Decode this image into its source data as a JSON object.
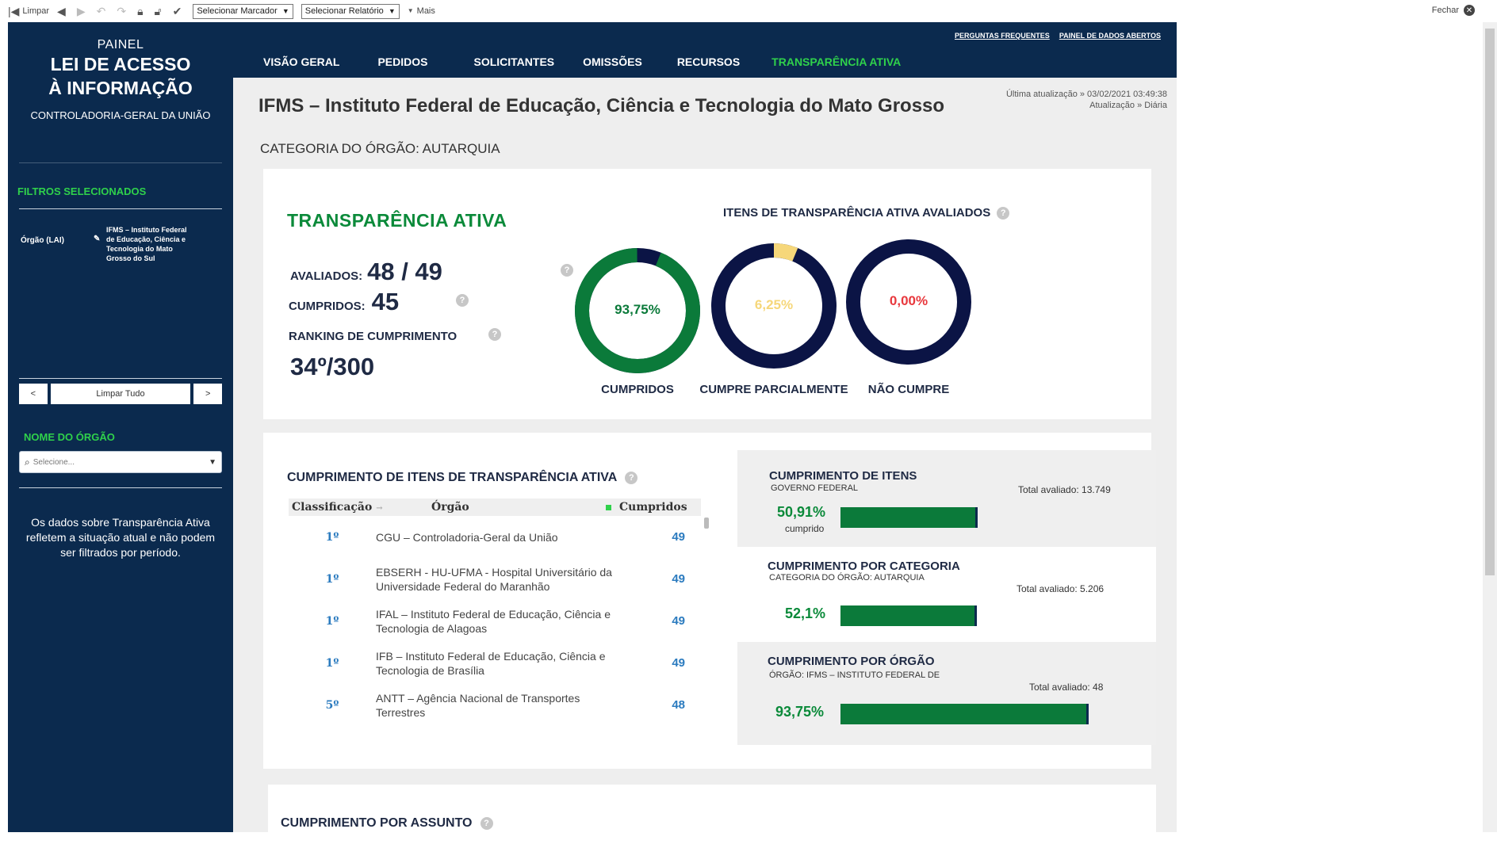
{
  "toolbar": {
    "clear": "Limpar",
    "select_bookmark": "Selecionar Marcador",
    "select_report": "Selecionar Relatório",
    "more": "Mais",
    "close": "Fechar"
  },
  "sidebar": {
    "brand": {
      "line1": "PAINEL",
      "line2": "LEI DE ACESSO",
      "line3": "À INFORMAÇÃO",
      "line4": "CONTROLADORIA-GERAL DA UNIÃO"
    },
    "filters_heading": "FILTROS SELECIONADOS",
    "filter": {
      "key": "Órgão (LAI)",
      "value": "IFMS – Instituto Federal de Educação, Ciência e Tecnologia do Mato Grosso do Sul"
    },
    "prev_label": "<",
    "clear_all": "Limpar Tudo",
    "next_label": ">",
    "org_heading": "NOME DO ÓRGÃO",
    "search_placeholder": "Selecione...",
    "note": "Os dados sobre Transparência Ativa refletem a situação atual e não podem ser filtrados por período."
  },
  "nav": {
    "links": [
      "PERGUNTAS FREQUENTES",
      "PAINEL DE DADOS ABERTOS"
    ],
    "tabs": [
      "VISÃO GERAL",
      "PEDIDOS",
      "SOLICITANTES",
      "OMISSÕES",
      "RECURSOS",
      "TRANSPARÊNCIA ATIVA"
    ],
    "active_tab": "TRANSPARÊNCIA ATIVA"
  },
  "header": {
    "title": "IFMS – Instituto Federal de Educação, Ciência e Tecnologia do Mato Grosso",
    "updated": "Última atualização » 03/02/2021 03:49:38",
    "frequency": "Atualização » Diária",
    "category": "CATEGORIA DO ÓRGÃO: AUTARQUIA"
  },
  "summary": {
    "title": "TRANSPARÊNCIA ATIVA",
    "evaluated_label": "AVALIADOS:",
    "evaluated_value": "48 / 49",
    "fulfilled_label": "CUMPRIDOS:",
    "fulfilled_value": "45",
    "ranking_label": "RANKING DE CUMPRIMENTO",
    "ranking_value": "34º/300",
    "help": "?"
  },
  "donuts": {
    "title": "ITENS DE TRANSPARÊNCIA ATIVA AVALIADOS",
    "items": [
      {
        "label": "CUMPRIDOS",
        "pct_text": "93,75%",
        "fraction": 0.9375,
        "fill_color": "#0b7a3a",
        "text_color": "#0b7a3a"
      },
      {
        "label": "CUMPRE PARCIALMENTE",
        "pct_text": "6,25%",
        "fraction": 0.0625,
        "fill_color": "#f6d77a",
        "text_color": "#f6d77a"
      },
      {
        "label": "NÃO CUMPRE",
        "pct_text": "0,00%",
        "fraction": 0.0,
        "fill_color": "#e8383d",
        "text_color": "#e8383d"
      }
    ],
    "track_color": "#0b1445"
  },
  "ranking": {
    "title": "CUMPRIMENTO DE ITENS DE TRANSPARÊNCIA ATIVA",
    "columns": [
      "Classificação",
      "Órgão",
      "Cumpridos"
    ],
    "sort_arrow": "→",
    "rows": [
      {
        "pos": "1º",
        "org": "CGU – Controladoria-Geral da União",
        "val": "49"
      },
      {
        "pos": "1º",
        "org": "EBSERH - HU-UFMA - Hospital Universitário da Universidade Federal do Maranhão",
        "val": "49"
      },
      {
        "pos": "1º",
        "org": "IFAL – Instituto Federal de Educação, Ciência e Tecnologia de Alagoas",
        "val": "49"
      },
      {
        "pos": "1º",
        "org": "IFB – Instituto Federal de Educação, Ciência e Tecnologia de Brasília",
        "val": "49"
      },
      {
        "pos": "5º",
        "org": "ANTT – Agência Nacional de Transportes Terrestres",
        "val": "48"
      }
    ]
  },
  "bars": [
    {
      "title": "CUMPRIMENTO DE ITENS",
      "subtitle": "GOVERNO FEDERAL",
      "total": "Total avaliado: 13.749",
      "pct_text": "50,91%",
      "note": "cumprido",
      "fraction": 0.5091
    },
    {
      "title": "CUMPRIMENTO POR CATEGORIA",
      "subtitle": "CATEGORIA DO ÓRGÃO: AUTARQUIA",
      "total": "Total avaliado: 5.206",
      "pct_text": "52,1%",
      "note": "",
      "fraction": 0.521
    },
    {
      "title": "CUMPRIMENTO POR ÓRGÃO",
      "subtitle": "ÓRGÃO: IFMS – INSTITUTO FEDERAL DE",
      "total": "Total avaliado: 48",
      "pct_text": "93,75%",
      "note": "",
      "fraction": 0.9375
    }
  ],
  "subject": {
    "title": "CUMPRIMENTO POR ASSUNTO"
  }
}
